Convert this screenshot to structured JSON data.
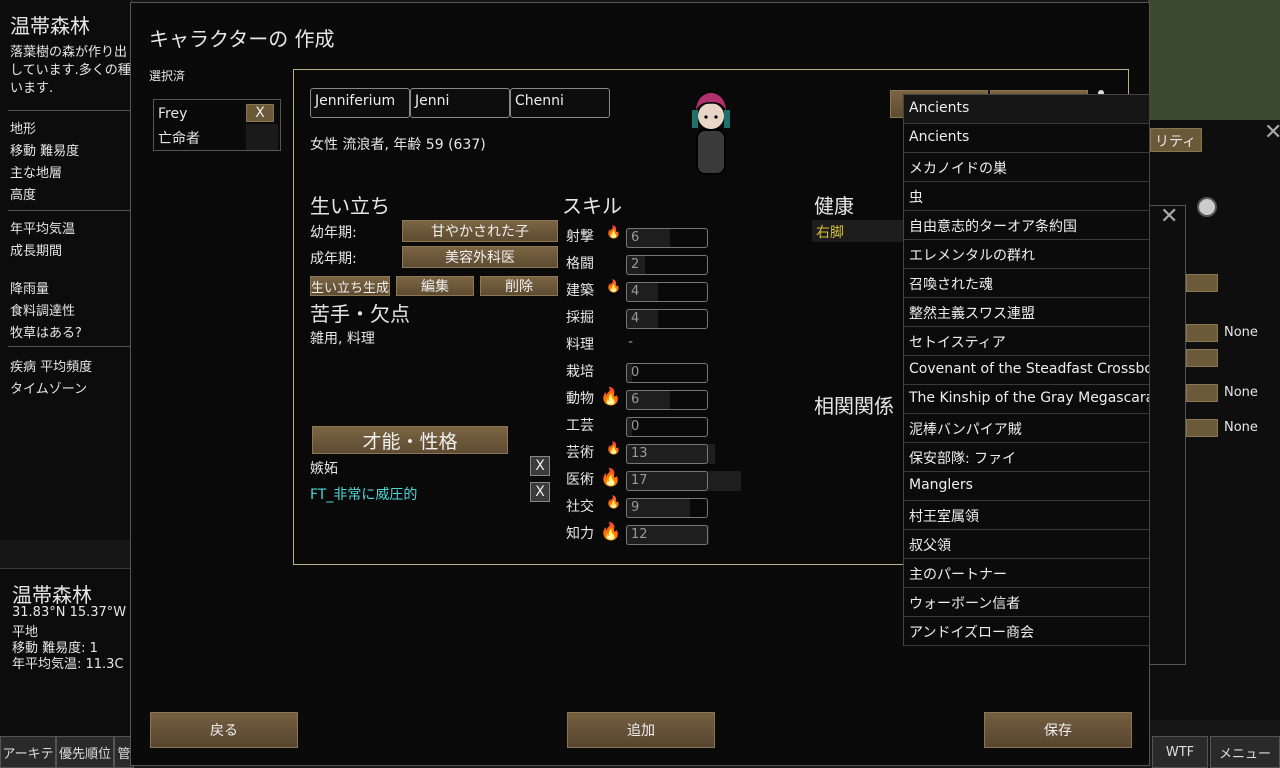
{
  "left_panel": {
    "title": "温帯森林",
    "description": "落葉樹の森が作り出\nしています.多くの種\nいます.",
    "rows_a": [
      "地形",
      "移動 難易度",
      "主な地層",
      "高度"
    ],
    "rows_b": [
      "年平均気温",
      "成長期間"
    ],
    "rows_c": [
      "降雨量",
      "食料調達性",
      "牧草はある?"
    ],
    "rows_d": [
      "疾病 平均頻度",
      "タイムゾーン"
    ]
  },
  "left_bottom": {
    "title": "温帯森林",
    "coords": "31.83°N 15.37°W",
    "terrain": "平地",
    "movement": "移動 難易度: 1",
    "avg_temp": "年平均気温: 11.3C"
  },
  "taskbar": {
    "left": [
      "アーキテ",
      "優先順位",
      "管"
    ],
    "right": [
      "WTF",
      "メニュー"
    ]
  },
  "dialog": {
    "title": "キャラクターの 作成",
    "selected_label": "選択済",
    "pawn": {
      "name": "Frey",
      "role": "亡命者",
      "remove": "X"
    },
    "names": {
      "first": "Jenniferium",
      "nick": "Jenni",
      "last": "Chenni"
    },
    "info": "女性 流浪者, 年齢 59 (637)",
    "backstory": {
      "heading": "生い立ち",
      "childhood_label": "幼年期:",
      "childhood_value": "甘やかされた子",
      "adulthood_label": "成年期:",
      "adulthood_value": "美容外科医",
      "generate": "生い立ち生成",
      "edit": "編集",
      "delete": "削除"
    },
    "incapable": {
      "heading": "苦手・欠点",
      "value": "雑用, 料理"
    },
    "traits": {
      "button": "才能・性格",
      "items": [
        {
          "name": "嫉妬",
          "color": "#e6e6e6"
        },
        {
          "name": "FT_非常に威圧的",
          "color": "#4fd6d6"
        }
      ],
      "remove": "X"
    },
    "skills": {
      "heading": "スキル",
      "items": [
        {
          "name": "射撃",
          "value": "6",
          "level": 6,
          "passion": 1
        },
        {
          "name": "格闘",
          "value": "2",
          "level": 2,
          "passion": 0
        },
        {
          "name": "建築",
          "value": "4",
          "level": 4,
          "passion": 1
        },
        {
          "name": "採掘",
          "value": "4",
          "level": 4,
          "passion": 0
        },
        {
          "name": "料理",
          "value": "-",
          "level": 0,
          "passion": 0,
          "disabled": true
        },
        {
          "name": "栽培",
          "value": "0",
          "level": 0,
          "passion": 0
        },
        {
          "name": "動物",
          "value": "6",
          "level": 6,
          "passion": 2
        },
        {
          "name": "工芸",
          "value": "0",
          "level": 0,
          "passion": 0
        },
        {
          "name": "芸術",
          "value": "13",
          "level": 13,
          "passion": 1
        },
        {
          "name": "医術",
          "value": "17",
          "level": 17,
          "passion": 2
        },
        {
          "name": "社交",
          "value": "9",
          "level": 9,
          "passion": 1
        },
        {
          "name": "知力",
          "value": "12",
          "level": 12,
          "passion": 2
        }
      ]
    },
    "health": {
      "heading": "健康",
      "item": "右脚",
      "item_color": "#d6c23a"
    },
    "relations": {
      "heading": "相関関係"
    },
    "buttons": {
      "back": "戻る",
      "add": "追加",
      "save": "保存"
    }
  },
  "dropdown": {
    "items": [
      "Ancients",
      "Ancients",
      "メカノイドの巣",
      "虫",
      "自由意志的ターオア条約国",
      "エレメンタルの群れ",
      "召喚された魂",
      "整然主義スワス連盟",
      "セトイスティア",
      "Covenant of the Steadfast Crossbow",
      "The Kinship of the Gray Megascarab",
      "泥棒バンパイア賊",
      "保安部隊: ファイ",
      "Manglers",
      "村王室属領",
      "叔父領",
      "主のパートナー",
      "ウォーボーン信者",
      "アンドイズロー商会"
    ]
  },
  "right_panel": {
    "tab_fragment": "リティ",
    "none_labels": [
      "None",
      "None",
      "None"
    ]
  }
}
